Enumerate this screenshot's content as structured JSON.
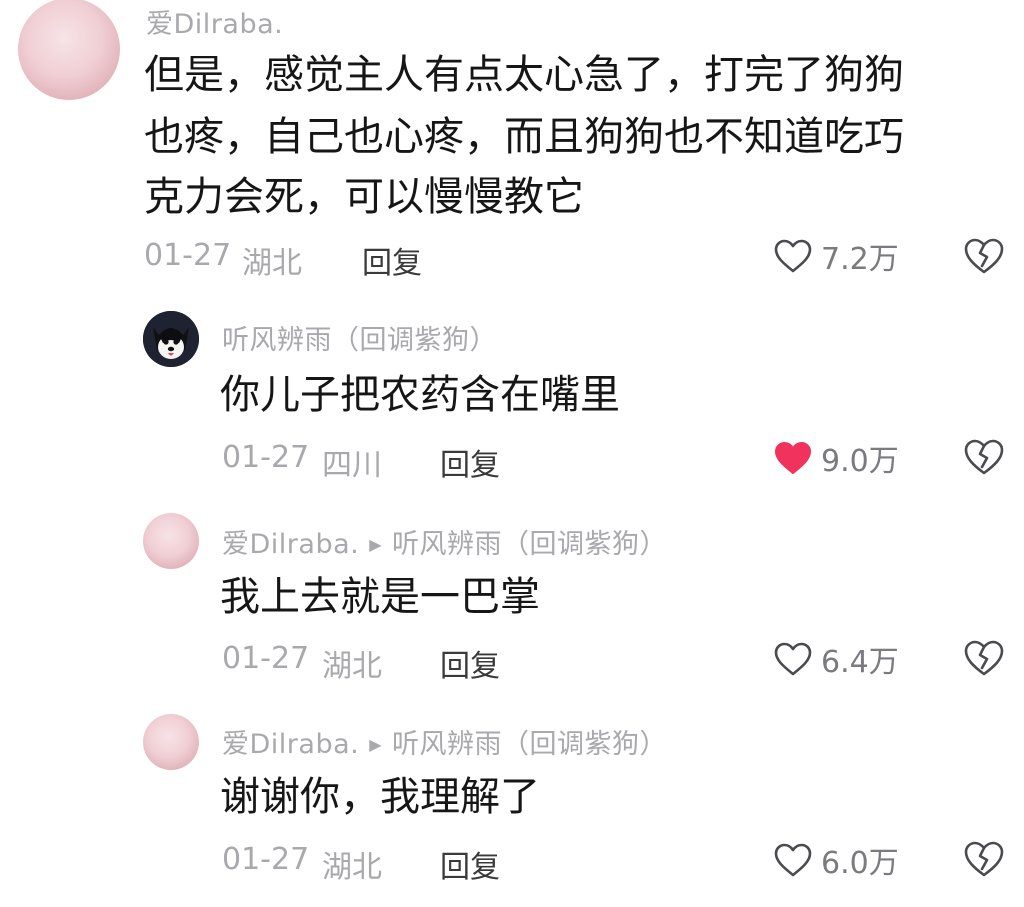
{
  "comments": [
    {
      "username": "爱Dilraba.",
      "lines": [
        "但是，感觉主人有点太心急了，打完了狗狗",
        "也疼，自己也心疼，而且狗狗也不知道吃巧",
        "克力会死，可以慢慢教它"
      ],
      "date": "01-27",
      "location": "湖北",
      "reply_label": "回复",
      "likes": "7.2万",
      "liked": false
    },
    {
      "username": "听风辨雨（回调紫狗）",
      "lines": [
        "你儿子把农药含在嘴里"
      ],
      "date": "01-27",
      "location": "四川",
      "reply_label": "回复",
      "likes": "9.0万",
      "liked": true
    },
    {
      "username": "爱Dilraba.",
      "reply_to": "听风辨雨（回调紫狗）",
      "lines": [
        "我上去就是一巴掌"
      ],
      "date": "01-27",
      "location": "湖北",
      "reply_label": "回复",
      "likes": "6.4万",
      "liked": false
    },
    {
      "username": "爱Dilraba.",
      "reply_to": "听风辨雨（回调紫狗）",
      "lines": [
        "谢谢你，我理解了"
      ],
      "date": "01-27",
      "location": "湖北",
      "reply_label": "回复",
      "likes": "6.0万",
      "liked": false
    }
  ],
  "icons": {
    "like": "heart-outline-icon",
    "liked": "heart-filled-icon",
    "dislike": "broken-heart-icon"
  },
  "colors": {
    "liked": "#f0325c",
    "meta": "#a9a9ad",
    "text": "#161616"
  }
}
